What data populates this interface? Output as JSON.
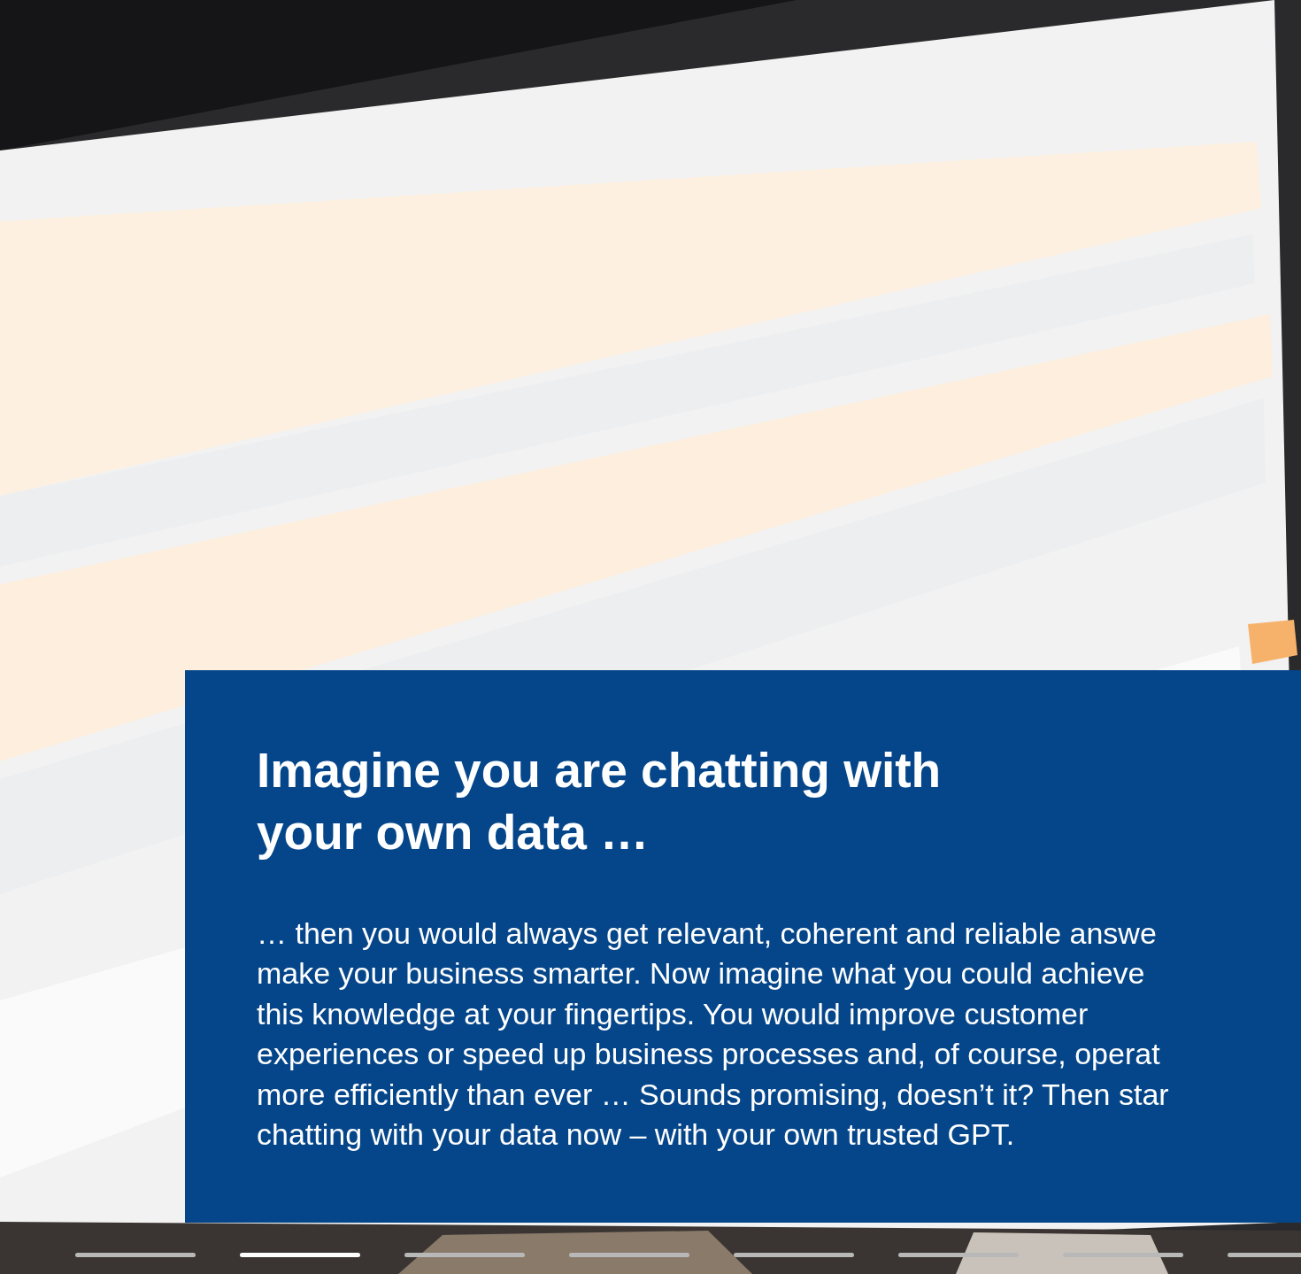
{
  "overlay": {
    "heading_lines": [
      "Imagine you are chatting with",
      "your own data …"
    ],
    "body_lines": [
      "… then you would always get relevant, coherent and reliable answe",
      "make your business smarter. Now imagine what you could achieve",
      "this knowledge at your fingertips. You would improve customer",
      "experiences or speed up business processes and, of course, operat",
      "more efficiently than ever … Sounds promising, doesn’t it? Then star",
      "chatting with your data now – with your own trusted GPT."
    ]
  },
  "carousel": [
    {
      "selected": false
    },
    {
      "selected": true
    },
    {
      "selected": false
    },
    {
      "selected": false
    },
    {
      "selected": false
    },
    {
      "selected": false
    },
    {
      "selected": false
    },
    {
      "selected": false
    }
  ]
}
